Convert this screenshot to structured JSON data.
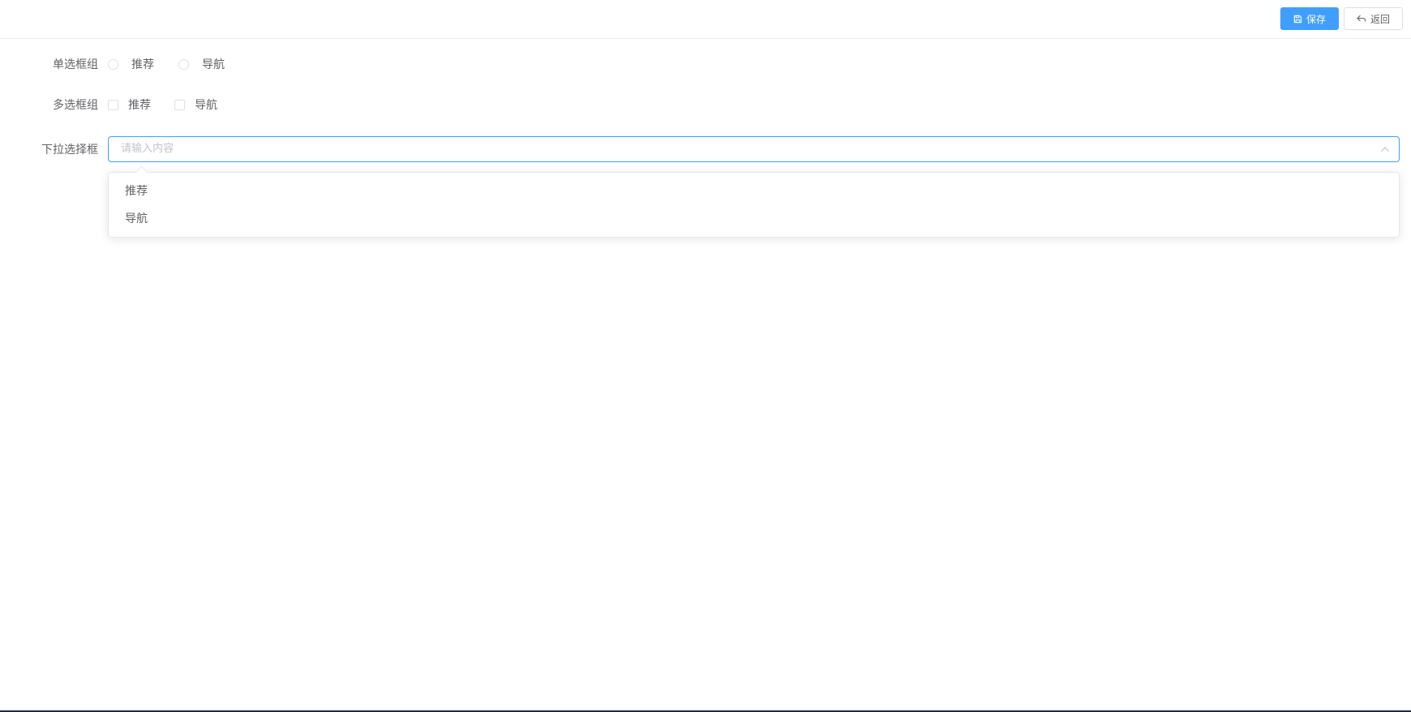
{
  "toolbar": {
    "save_label": "保存",
    "back_label": "返回"
  },
  "form": {
    "radio_group": {
      "label": "单选框组",
      "options": [
        "推荐",
        "导航"
      ]
    },
    "checkbox_group": {
      "label": "多选框组",
      "options": [
        "推荐",
        "导航"
      ]
    },
    "select": {
      "label": "下拉选择框",
      "placeholder": "请输入内容",
      "value": "",
      "options": [
        "推荐",
        "导航"
      ]
    }
  },
  "colors": {
    "primary": "#409eff",
    "text": "#606266",
    "placeholder": "#c0c4cc",
    "border": "#dcdfe6"
  }
}
